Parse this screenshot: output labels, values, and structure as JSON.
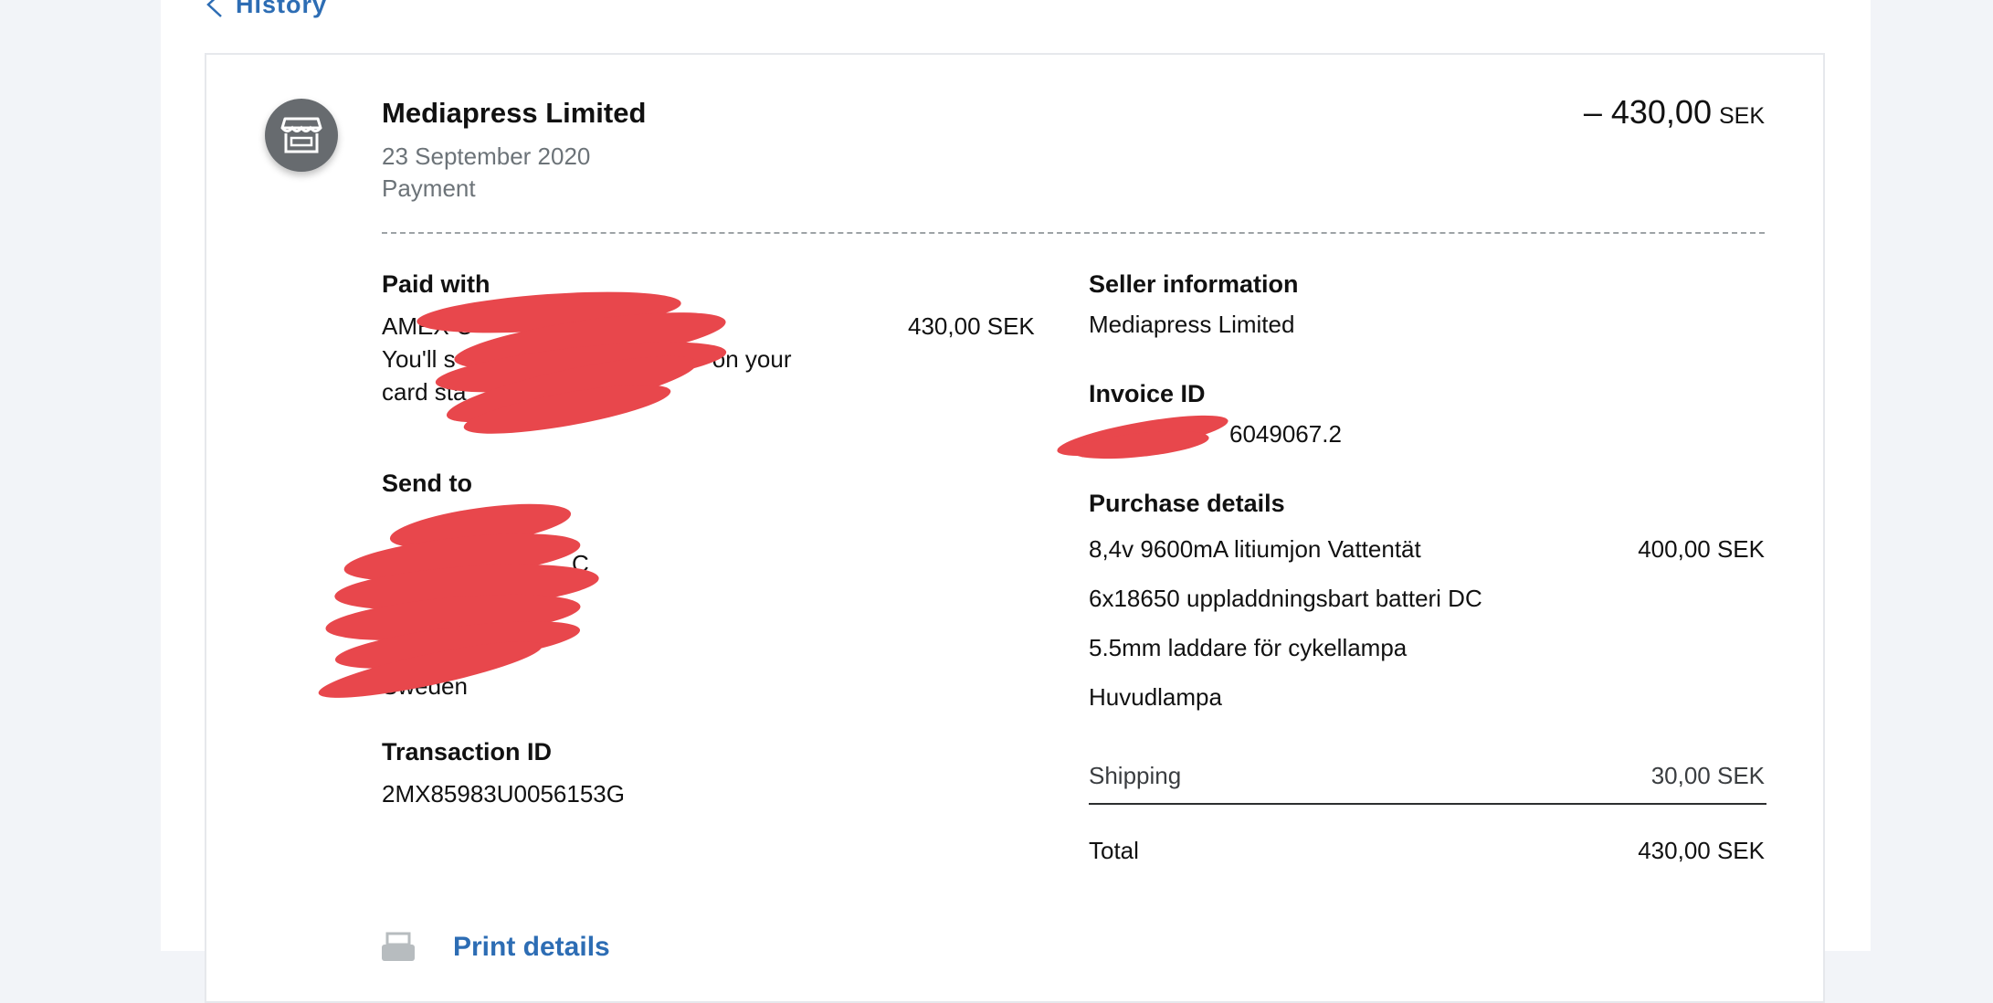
{
  "nav": {
    "back_label": "History"
  },
  "transaction": {
    "merchant": "Mediapress Limited",
    "date": "23 September 2020",
    "type": "Payment",
    "amount": "– 430,00",
    "currency": "SEK"
  },
  "paid_with": {
    "heading": "Paid with",
    "method_visible": "AMEX C",
    "method_tail": "X",
    "amount": "430,00 SEK",
    "note_line1_start": "You'll s",
    "note_line1_end": "SS\" on your",
    "note_line2_start": "card sta"
  },
  "send_to": {
    "heading": "Send to",
    "line_fragment": "C",
    "country": "Sweden"
  },
  "transaction_id": {
    "heading": "Transaction ID",
    "value": "2MX85983U0056153G"
  },
  "seller": {
    "heading": "Seller information",
    "name": "Mediapress Limited"
  },
  "invoice": {
    "heading": "Invoice ID",
    "value_visible": "6049067.2"
  },
  "purchase": {
    "heading": "Purchase details",
    "items": [
      {
        "name": "8,4v 9600mA litiumjon Vattentät",
        "amount": "400,00 SEK"
      },
      {
        "name": "6x18650 uppladdningsbart batteri DC",
        "amount": ""
      },
      {
        "name": "5.5mm laddare för cykellampa",
        "amount": ""
      },
      {
        "name": "Huvudlampa",
        "amount": ""
      }
    ],
    "shipping_label": "Shipping",
    "shipping_amount": "30,00 SEK",
    "total_label": "Total",
    "total_amount": "430,00 SEK"
  },
  "actions": {
    "print_label": "Print details"
  },
  "colors": {
    "link": "#2d6db4",
    "redaction": "#e8474c",
    "avatar": "#676b6f"
  }
}
